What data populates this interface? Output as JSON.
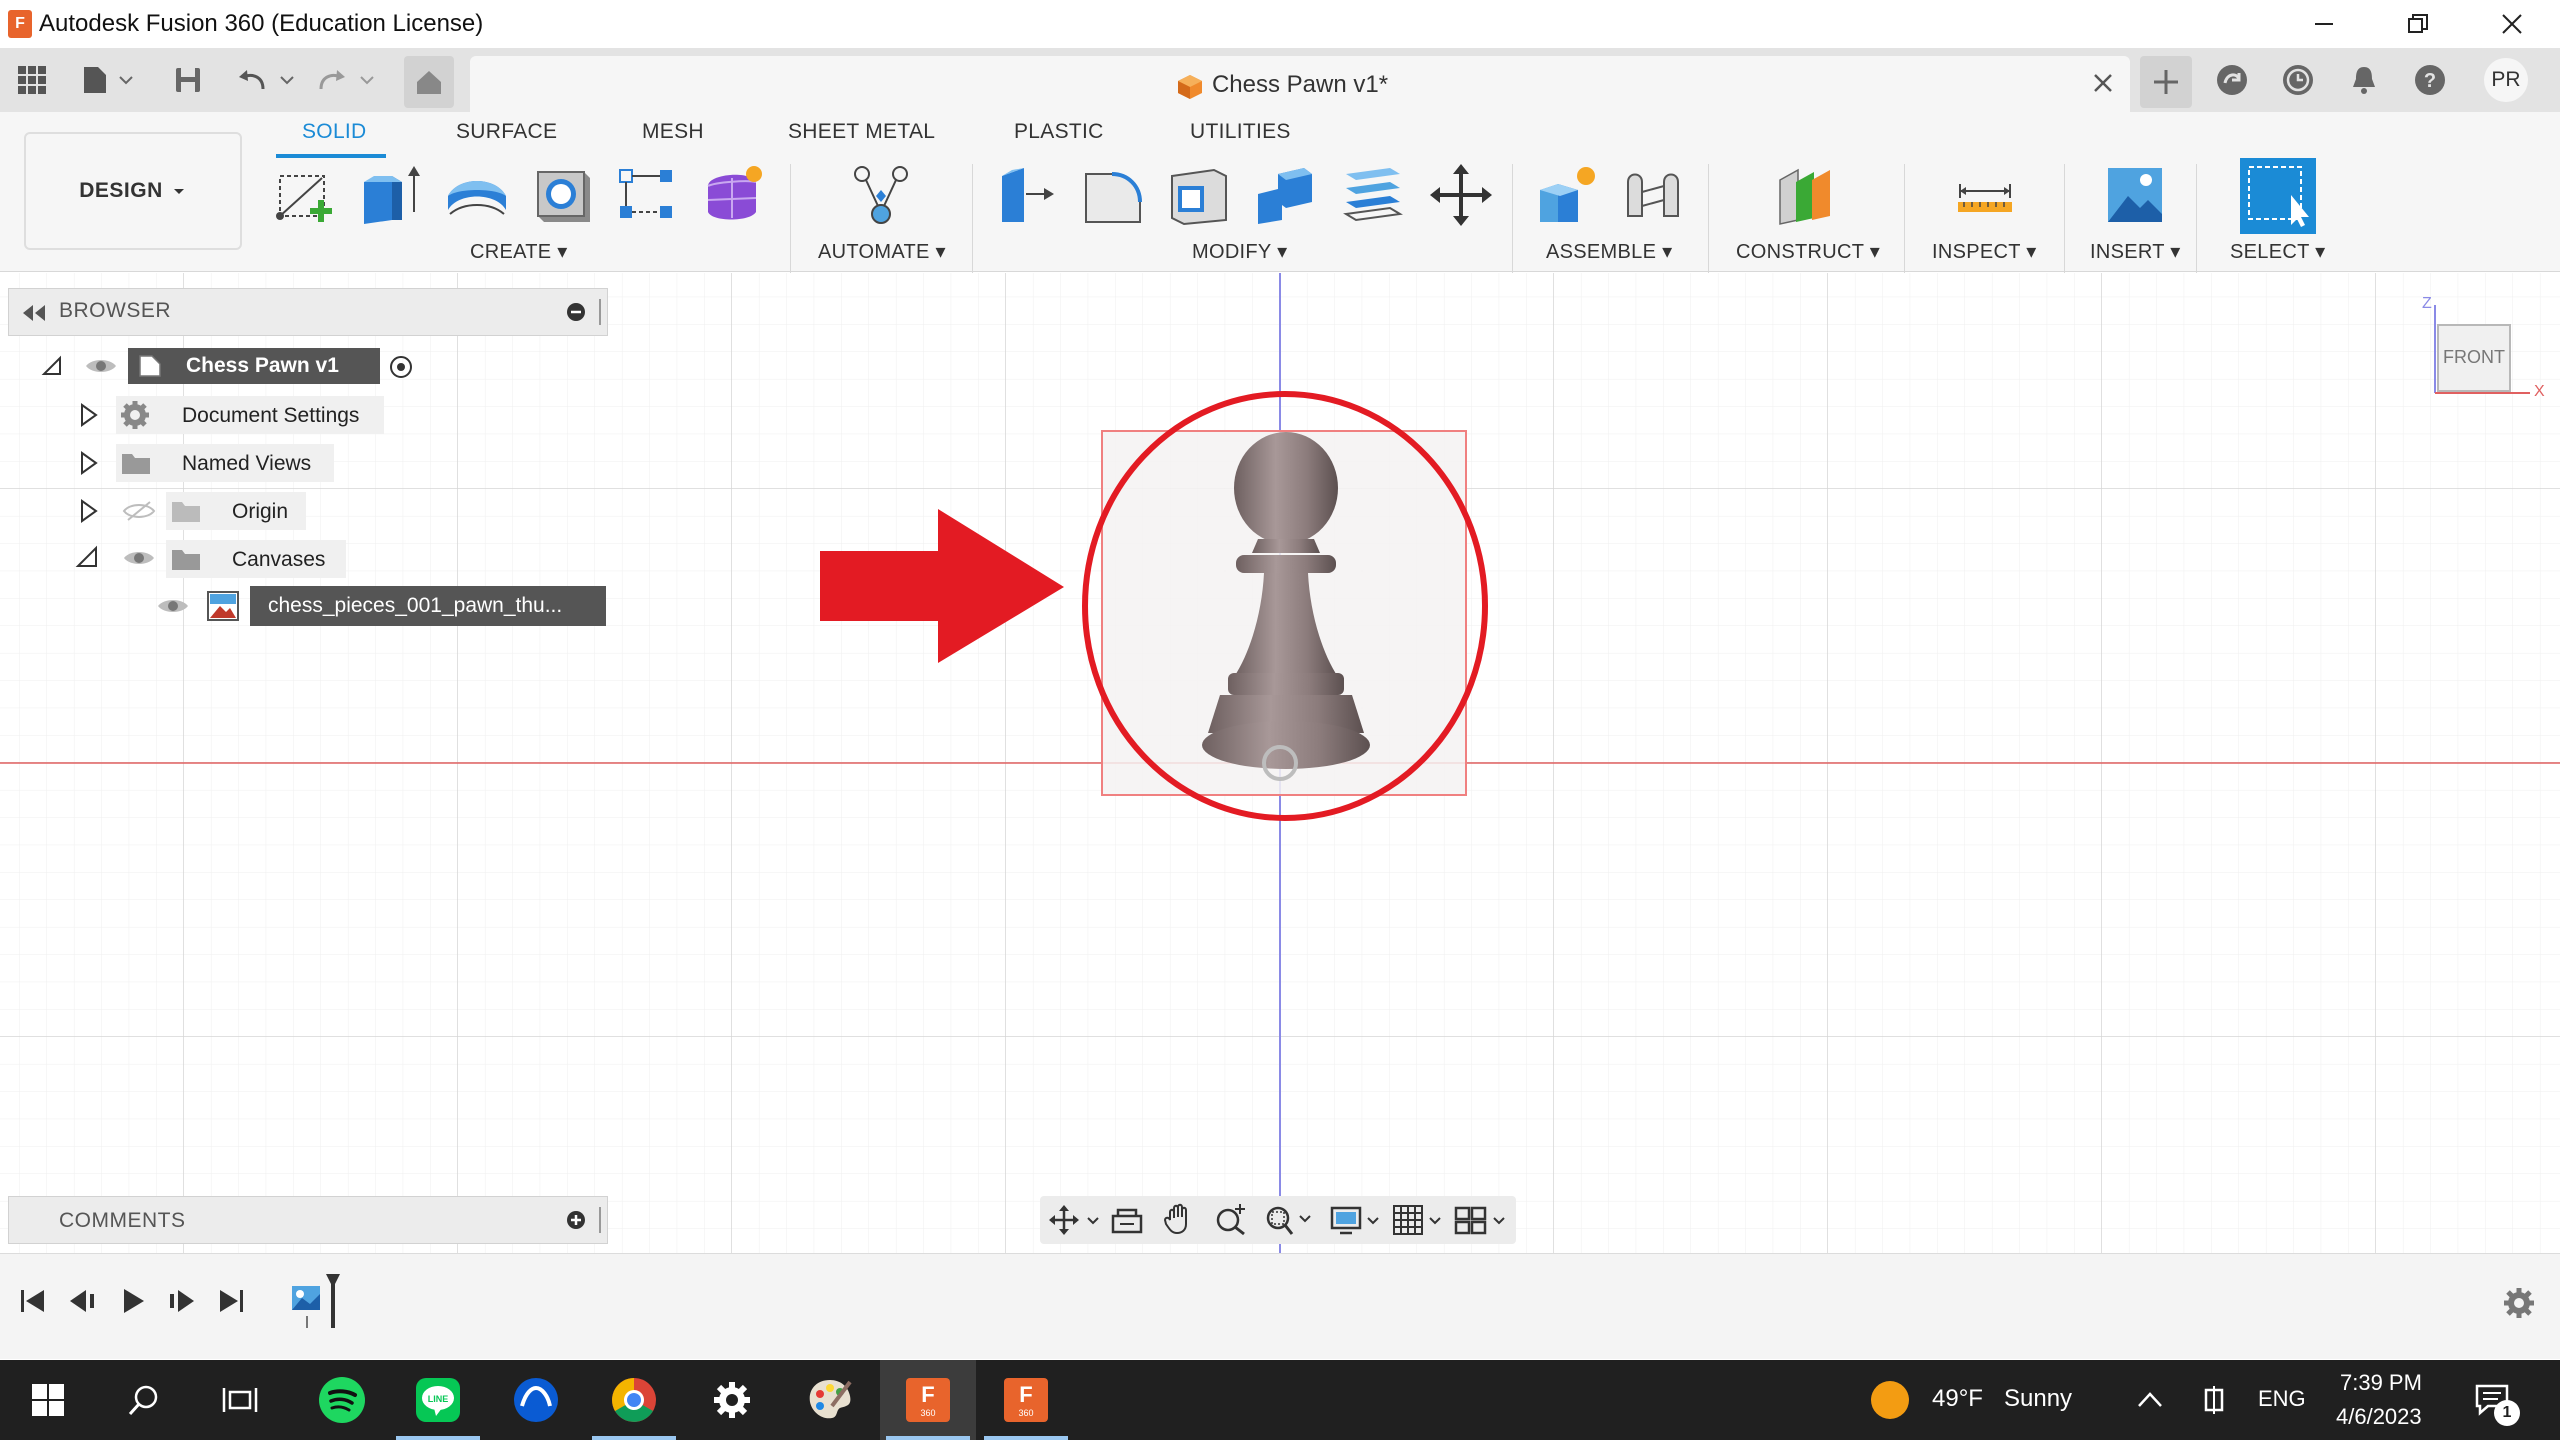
{
  "window": {
    "title": "Autodesk Fusion 360 (Education License)",
    "app_icon_letter": "F"
  },
  "document": {
    "tab_title": "Chess Pawn v1*"
  },
  "user": {
    "initials": "PR"
  },
  "toolbar": {
    "workspace_label": "DESIGN",
    "tabs": [
      "SOLID",
      "SURFACE",
      "MESH",
      "SHEET METAL",
      "PLASTIC",
      "UTILITIES"
    ],
    "active_tab": "SOLID",
    "groups": {
      "create": "CREATE",
      "automate": "AUTOMATE",
      "modify": "MODIFY",
      "assemble": "ASSEMBLE",
      "construct": "CONSTRUCT",
      "inspect": "INSPECT",
      "insert": "INSERT",
      "select": "SELECT"
    }
  },
  "browser": {
    "header": "BROWSER",
    "root": "Chess Pawn v1",
    "items": [
      {
        "label": "Document Settings",
        "icon": "gear-icon"
      },
      {
        "label": "Named Views",
        "icon": "folder-icon"
      },
      {
        "label": "Origin",
        "icon": "folder-icon",
        "visibility": "hidden"
      },
      {
        "label": "Canvases",
        "icon": "folder-icon",
        "expanded": true
      }
    ],
    "canvas_item": "chess_pieces_001_pawn_thu..."
  },
  "comments": {
    "header": "COMMENTS"
  },
  "viewcube": {
    "face": "FRONT",
    "axis_z": "Z",
    "axis_x": "X"
  },
  "taskbar": {
    "weather_temp": "49°F",
    "weather_condition": "Sunny",
    "language": "ENG",
    "time": "7:39 PM",
    "date": "4/6/2023",
    "notification_count": "1",
    "fusion_icon_label": "360"
  },
  "colors": {
    "accent": "#1b8bd6",
    "annotation_red": "#e31b23",
    "grid_line": "#e8e8e8",
    "x_axis": "#e06060",
    "z_axis": "#8a8ae6"
  }
}
